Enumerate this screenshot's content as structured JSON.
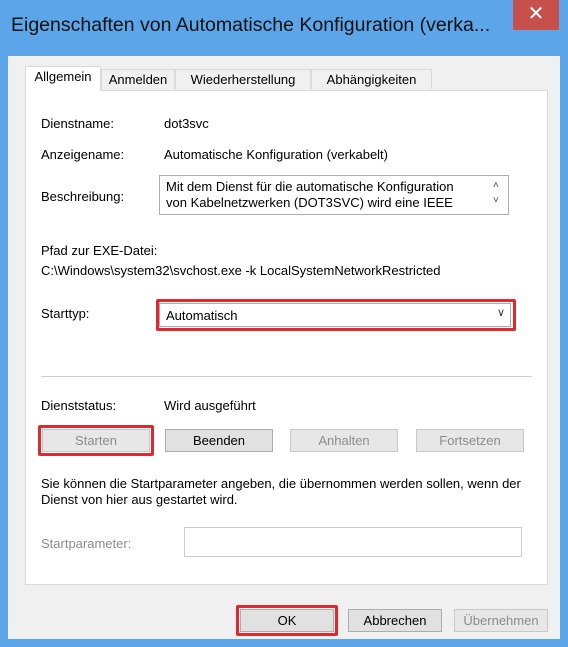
{
  "window": {
    "title": "Eigenschaften von Automatische Konfiguration (verka...",
    "close_glyph": "✕"
  },
  "tabs": [
    {
      "label": "Allgemein",
      "active": true
    },
    {
      "label": "Anmelden",
      "active": false
    },
    {
      "label": "Wiederherstellung",
      "active": false
    },
    {
      "label": "Abhängigkeiten",
      "active": false
    }
  ],
  "general": {
    "service_name_label": "Dienstname:",
    "service_name_value": "dot3svc",
    "display_name_label": "Anzeigename:",
    "display_name_value": "Automatische Konfiguration (verkabelt)",
    "description_label": "Beschreibung:",
    "description_value": "Mit dem Dienst für die automatische Konfiguration von Kabelnetzwerken (DOT3SVC) wird eine IEEE",
    "path_label": "Pfad zur EXE-Datei:",
    "path_value": "C:\\Windows\\system32\\svchost.exe -k LocalSystemNetworkRestricted",
    "startup_type_label": "Starttyp:",
    "startup_type_value": "Automatisch",
    "status_label": "Dienststatus:",
    "status_value": "Wird ausgeführt",
    "buttons": {
      "start": "Starten",
      "stop": "Beenden",
      "pause": "Anhalten",
      "resume": "Fortsetzen"
    },
    "hint": "Sie können die Startparameter angeben, die übernommen werden sollen, wenn der Dienst von hier aus gestartet wird.",
    "start_params_label": "Startparameter:",
    "start_params_value": ""
  },
  "footer": {
    "ok": "OK",
    "cancel": "Abbrechen",
    "apply": "Übernehmen"
  },
  "colors": {
    "titlebar": "#5ca5e8",
    "close": "#c7504c",
    "highlight": "#e3262f"
  },
  "icons": {
    "scroll_up": "˄",
    "scroll_down": "˅",
    "dropdown": "∨"
  }
}
